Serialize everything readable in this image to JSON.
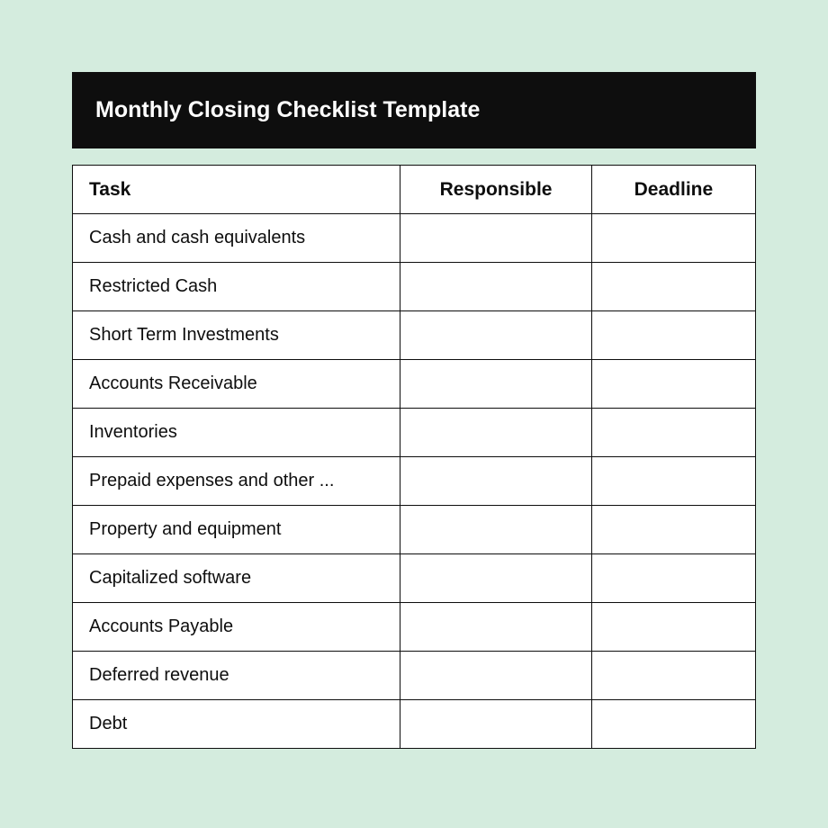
{
  "title": "Monthly Closing Checklist Template",
  "columns": {
    "task": "Task",
    "responsible": "Responsible",
    "deadline": "Deadline"
  },
  "rows": [
    {
      "task": "Cash and cash equivalents",
      "responsible": "",
      "deadline": ""
    },
    {
      "task": "Restricted Cash",
      "responsible": "",
      "deadline": ""
    },
    {
      "task": "Short Term Investments",
      "responsible": "",
      "deadline": ""
    },
    {
      "task": "Accounts Receivable",
      "responsible": "",
      "deadline": ""
    },
    {
      "task": "Inventories",
      "responsible": "",
      "deadline": ""
    },
    {
      "task": "Prepaid expenses and other ...",
      "responsible": "",
      "deadline": ""
    },
    {
      "task": "Property and equipment",
      "responsible": "",
      "deadline": ""
    },
    {
      "task": "Capitalized software",
      "responsible": "",
      "deadline": ""
    },
    {
      "task": "Accounts Payable",
      "responsible": "",
      "deadline": ""
    },
    {
      "task": "Deferred revenue",
      "responsible": "",
      "deadline": ""
    },
    {
      "task": "Debt",
      "responsible": "",
      "deadline": ""
    }
  ]
}
